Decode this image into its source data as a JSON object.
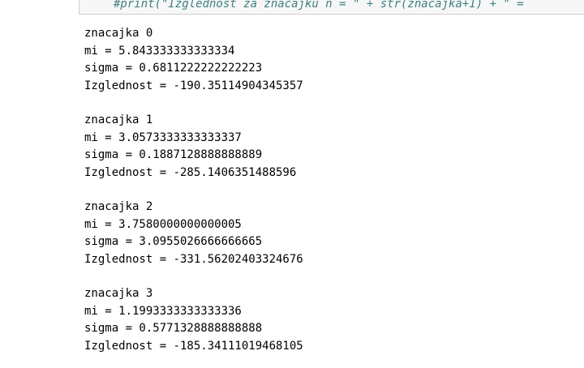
{
  "code_cell": {
    "line": "#print(\"Izglednost za znacajku n = \" + str(znacajka+1) + \" = "
  },
  "output": {
    "blocks": [
      {
        "heading": "znacajka 0",
        "mi": "mi = 5.843333333333334",
        "sigma": "sigma = 0.6811222222222223",
        "izglednost": "Izglednost = -190.35114904345357"
      },
      {
        "heading": "znacajka 1",
        "mi": "mi = 3.0573333333333337",
        "sigma": "sigma = 0.1887128888888889",
        "izglednost": "Izglednost = -285.1406351488596"
      },
      {
        "heading": "znacajka 2",
        "mi": "mi = 3.7580000000000005",
        "sigma": "sigma = 3.0955026666666665",
        "izglednost": "Izglednost = -331.56202403324676"
      },
      {
        "heading": "znacajka 3",
        "mi": "mi = 1.1993333333333336",
        "sigma": "sigma = 0.5771328888888888",
        "izglednost": "Izglednost = -185.34111019468105"
      }
    ]
  }
}
